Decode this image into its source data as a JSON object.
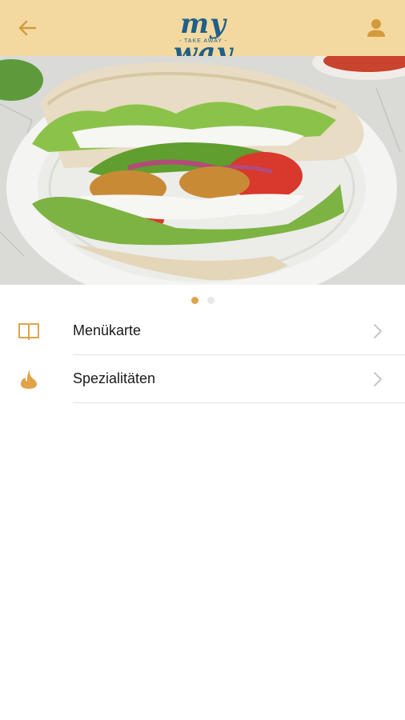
{
  "header": {
    "logo_text": "my way",
    "logo_subtext": "- TAKE AWAY -",
    "accent_color": "#f3d9a0",
    "back_icon": "arrow-left-icon",
    "profile_icon": "user-icon"
  },
  "carousel": {
    "slide_count": 2,
    "active_index": 0,
    "image_description": "Falafel pita sandwich with lettuce, avocado, tomato, onion and yogurt sauce",
    "dot_active_color": "#e0a348"
  },
  "menu": {
    "items": [
      {
        "label": "Menükarte",
        "icon": "book-icon"
      },
      {
        "label": "Spezialitäten",
        "icon": "flame-icon"
      }
    ],
    "icon_color": "#e0a348"
  }
}
